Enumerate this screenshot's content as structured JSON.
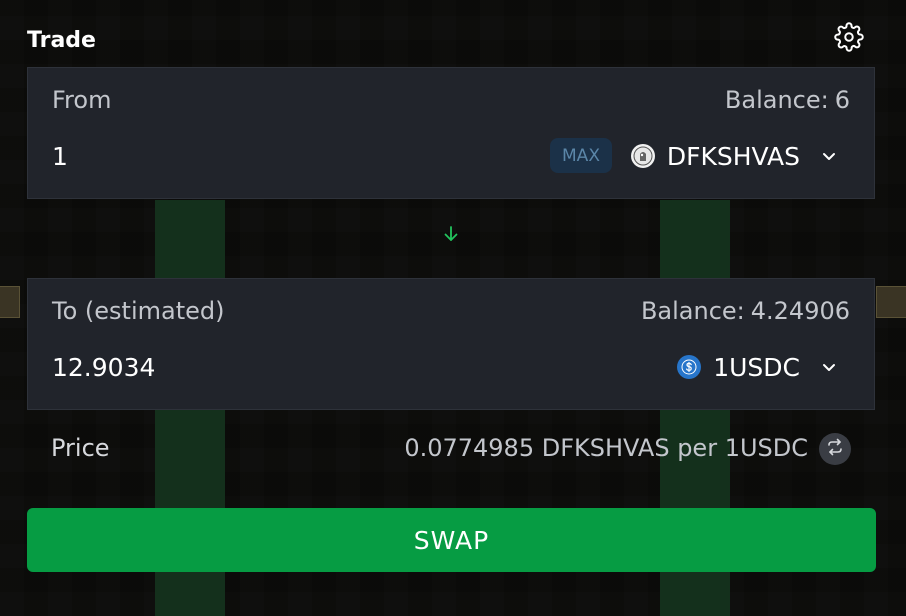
{
  "header": {
    "title": "Trade",
    "settings_icon": "gear-icon"
  },
  "from": {
    "label": "From",
    "balance_label": "Balance:",
    "balance_value": "6",
    "amount": "1",
    "max_label": "MAX",
    "token": "DFKSHVAS",
    "token_icon": "dfkshvas-token-icon"
  },
  "flip": {
    "icon": "arrow-down-icon",
    "color": "#22c55e"
  },
  "to": {
    "label": "To (estimated)",
    "balance_label": "Balance:",
    "balance_value": "4.24906",
    "amount": "12.9034",
    "token": "1USDC",
    "token_icon": "usdc-token-icon"
  },
  "price": {
    "label": "Price",
    "value": "0.0774985 DFKSHVAS per 1USDC",
    "invert_icon": "swap-arrows-icon"
  },
  "swap_button": {
    "label": "SWAP",
    "color": "#069c43"
  },
  "colors": {
    "panel_bg": "#21242b",
    "max_bg": "#1b3148",
    "accent_green": "#069c43"
  }
}
